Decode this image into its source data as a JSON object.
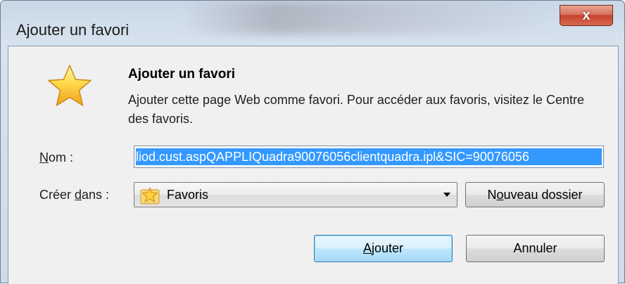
{
  "window": {
    "title": "Ajouter un favori",
    "close_glyph": "x"
  },
  "header": {
    "icon": "favorites-star-icon",
    "title": "Ajouter un favori",
    "description": "Ajouter cette page Web comme favori. Pour accéder aux favoris, visitez le Centre des favoris."
  },
  "form": {
    "name_label_accel": "N",
    "name_label_rest": "om :",
    "name_value": "liod.cust.aspQAPPLIQuadra90076056clientquadra.ipl&SIC=90076056",
    "create_in_label_pre": "Créer ",
    "create_in_label_accel": "d",
    "create_in_label_post": "ans :",
    "create_in_value": "Favoris",
    "create_in_icon": "favorites-folder-star-icon"
  },
  "buttons": {
    "new_folder_pre": "N",
    "new_folder_accel": "o",
    "new_folder_post": "uveau dossier",
    "add_accel": "A",
    "add_rest": "jouter",
    "cancel": "Annuler"
  },
  "colors": {
    "selection": "#3399ff",
    "close_button": "#c7432c",
    "frame": "#cfdbe8",
    "client_bg": "#f0f0f0",
    "default_button_border": "#3c7fb1"
  }
}
